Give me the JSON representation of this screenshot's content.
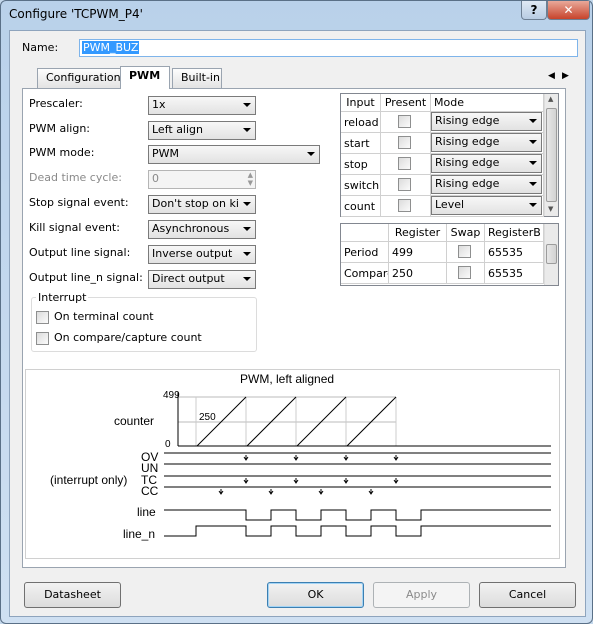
{
  "window": {
    "title": "Configure 'TCPWM_P4'",
    "help": "?",
    "close": "✕"
  },
  "name_label": "Name:",
  "name_value": "PWM_BUZ",
  "tabs": [
    {
      "label": "Configuration"
    },
    {
      "label": "PWM"
    },
    {
      "label": "Built-in"
    }
  ],
  "tab_nav": {
    "prev": "◀",
    "next": "▶"
  },
  "form": {
    "prescaler": {
      "label": "Prescaler:",
      "value": "1x"
    },
    "pwm_align": {
      "label": "PWM align:",
      "value": "Left align"
    },
    "pwm_mode": {
      "label": "PWM mode:",
      "value": "PWM"
    },
    "dead_time": {
      "label": "Dead time cycle:",
      "value": "0"
    },
    "stop_signal": {
      "label": "Stop signal event:",
      "value": "Don't stop on kil"
    },
    "kill_signal": {
      "label": "Kill signal event:",
      "value": "Asynchronous"
    },
    "output_line": {
      "label": "Output line signal:",
      "value": "Inverse output"
    },
    "output_line_n": {
      "label": "Output line_n signal:",
      "value": "Direct output"
    }
  },
  "interrupt": {
    "title": "Interrupt",
    "on_terminal": "On terminal count",
    "on_compare": "On compare/capture count"
  },
  "inputs_table": {
    "headers": [
      "Input",
      "Present",
      "Mode"
    ],
    "rows": [
      {
        "input": "reload",
        "present": false,
        "mode": "Rising edge"
      },
      {
        "input": "start",
        "present": false,
        "mode": "Rising edge"
      },
      {
        "input": "stop",
        "present": false,
        "mode": "Rising edge"
      },
      {
        "input": "switch",
        "present": false,
        "mode": "Rising edge"
      },
      {
        "input": "count",
        "present": false,
        "mode": "Level"
      }
    ]
  },
  "reg_table": {
    "headers": [
      "",
      "Register",
      "Swap",
      "RegisterB"
    ],
    "rows": [
      {
        "name": "Period",
        "register": "499",
        "swap": false,
        "registerb": "65535"
      },
      {
        "name": "Compare",
        "register": "250",
        "swap": false,
        "registerb": "65535"
      }
    ]
  },
  "diagram": {
    "title": "PWM, left aligned",
    "counter_label": "counter",
    "max_label": "499",
    "mid_label": "250",
    "zero_label": "0",
    "interrupt_only_label": "(interrupt only)",
    "signals": [
      "OV",
      "UN",
      "TC",
      "CC"
    ],
    "line_label": "line",
    "line_n_label": "line_n"
  },
  "buttons": {
    "datasheet": "Datasheet",
    "ok": "OK",
    "apply": "Apply",
    "cancel": "Cancel"
  }
}
